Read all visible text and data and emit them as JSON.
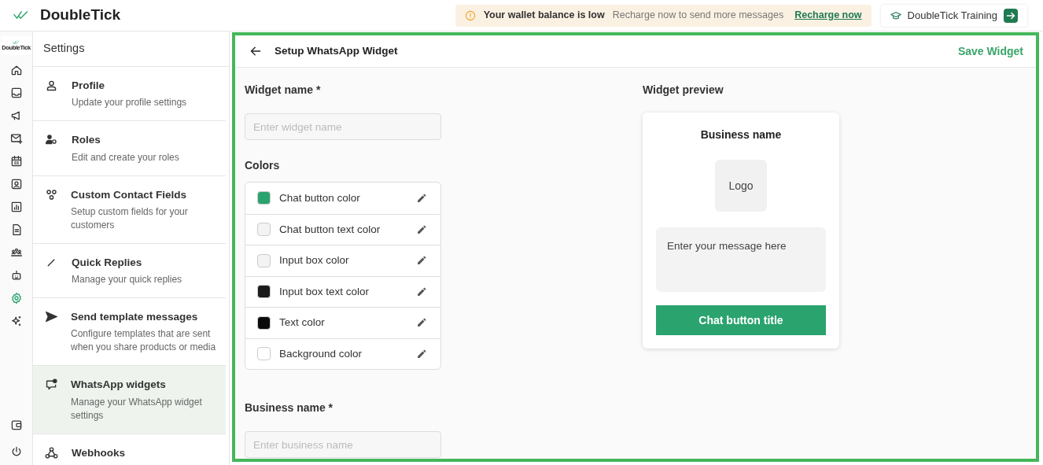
{
  "app": {
    "name": "DoubleTick",
    "rail_logo_text": "DoubleTick"
  },
  "banner": {
    "title": "Your wallet balance is low",
    "message": "Recharge now to send more messages",
    "link": "Recharge now"
  },
  "training_button": "DoubleTick Training",
  "rail": {
    "items": [
      {
        "selected": false
      },
      {
        "selected": false
      },
      {
        "selected": false
      },
      {
        "selected": false
      },
      {
        "selected": false
      },
      {
        "selected": false
      },
      {
        "selected": false
      },
      {
        "selected": false
      },
      {
        "selected": false
      },
      {
        "selected": false
      },
      {
        "selected": true
      },
      {
        "selected": false
      }
    ],
    "bottom": [
      {
        "selected": false
      },
      {
        "selected": false
      }
    ]
  },
  "settings": {
    "title": "Settings",
    "items": [
      {
        "title": "Profile",
        "subtitle": "Update your profile settings",
        "selected": false
      },
      {
        "title": "Roles",
        "subtitle": "Edit and create your roles",
        "selected": false
      },
      {
        "title": "Custom Contact Fields",
        "subtitle": "Setup custom fields for your customers",
        "selected": false
      },
      {
        "title": "Quick Replies",
        "subtitle": "Manage your quick replies",
        "selected": false
      },
      {
        "title": "Send template messages",
        "subtitle": "Configure templates that are sent when you share products or media",
        "selected": false
      },
      {
        "title": "WhatsApp widgets",
        "subtitle": "Manage your WhatsApp widget settings",
        "selected": true
      },
      {
        "title": "Webhooks",
        "selected": false
      }
    ]
  },
  "page": {
    "title": "Setup WhatsApp Widget",
    "save": "Save Widget",
    "widget_name": {
      "label": "Widget name *",
      "placeholder": "Enter widget name"
    },
    "colors": {
      "label": "Colors",
      "items": [
        {
          "name": "Chat button color",
          "color": "#2aa36e"
        },
        {
          "name": "Chat button text color",
          "color": "#f3f3f3"
        },
        {
          "name": "Input box color",
          "color": "#f3f3f3"
        },
        {
          "name": "Input box text color",
          "color": "#1b1b1b"
        },
        {
          "name": "Text color",
          "color": "#0b0b0b"
        },
        {
          "name": "Background color",
          "color": "#ffffff"
        }
      ]
    },
    "business_name": {
      "label": "Business name *",
      "placeholder": "Enter business name"
    },
    "preview": {
      "label": "Widget preview",
      "business_name": "Business name",
      "logo": "Logo",
      "message_placeholder": "Enter your message here",
      "button": "Chat button title"
    }
  }
}
